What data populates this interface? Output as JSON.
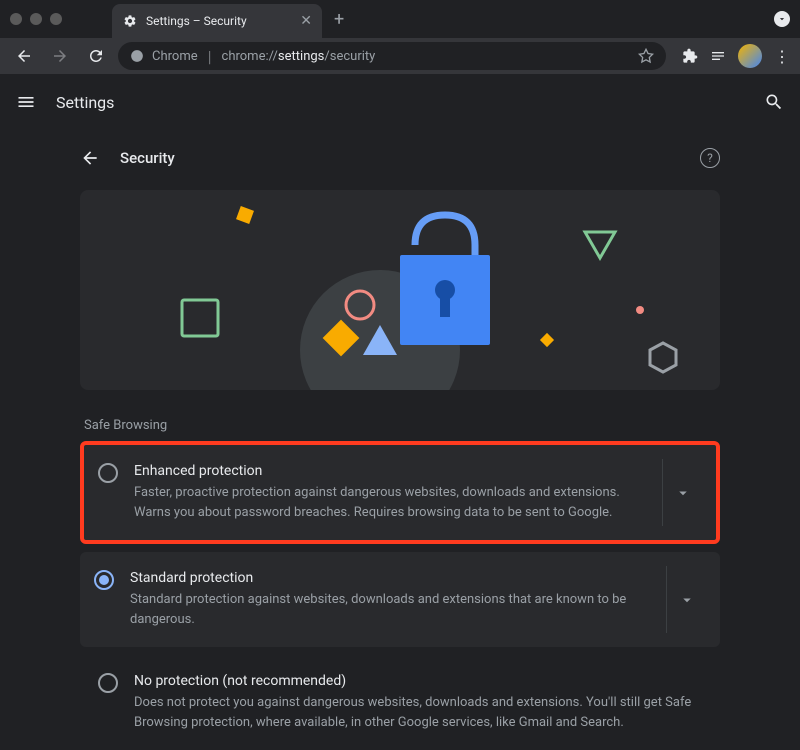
{
  "tab": {
    "title": "Settings – Security"
  },
  "omnibox": {
    "label": "Chrome",
    "prefix": "chrome://",
    "bold": "settings",
    "suffix": "/security"
  },
  "app": {
    "title": "Settings"
  },
  "page": {
    "title": "Security"
  },
  "section": {
    "label": "Safe Browsing"
  },
  "options": {
    "enhanced": {
      "title": "Enhanced protection",
      "desc": "Faster, proactive protection against dangerous websites, downloads and extensions. Warns you about password breaches. Requires browsing data to be sent to Google."
    },
    "standard": {
      "title": "Standard protection",
      "desc": "Standard protection against websites, downloads and extensions that are known to be dangerous."
    },
    "none": {
      "title": "No protection (not recommended)",
      "desc": "Does not protect you against dangerous websites, downloads and extensions. You'll still get Safe Browsing protection, where available, in other Google services, like Gmail and Search."
    }
  }
}
